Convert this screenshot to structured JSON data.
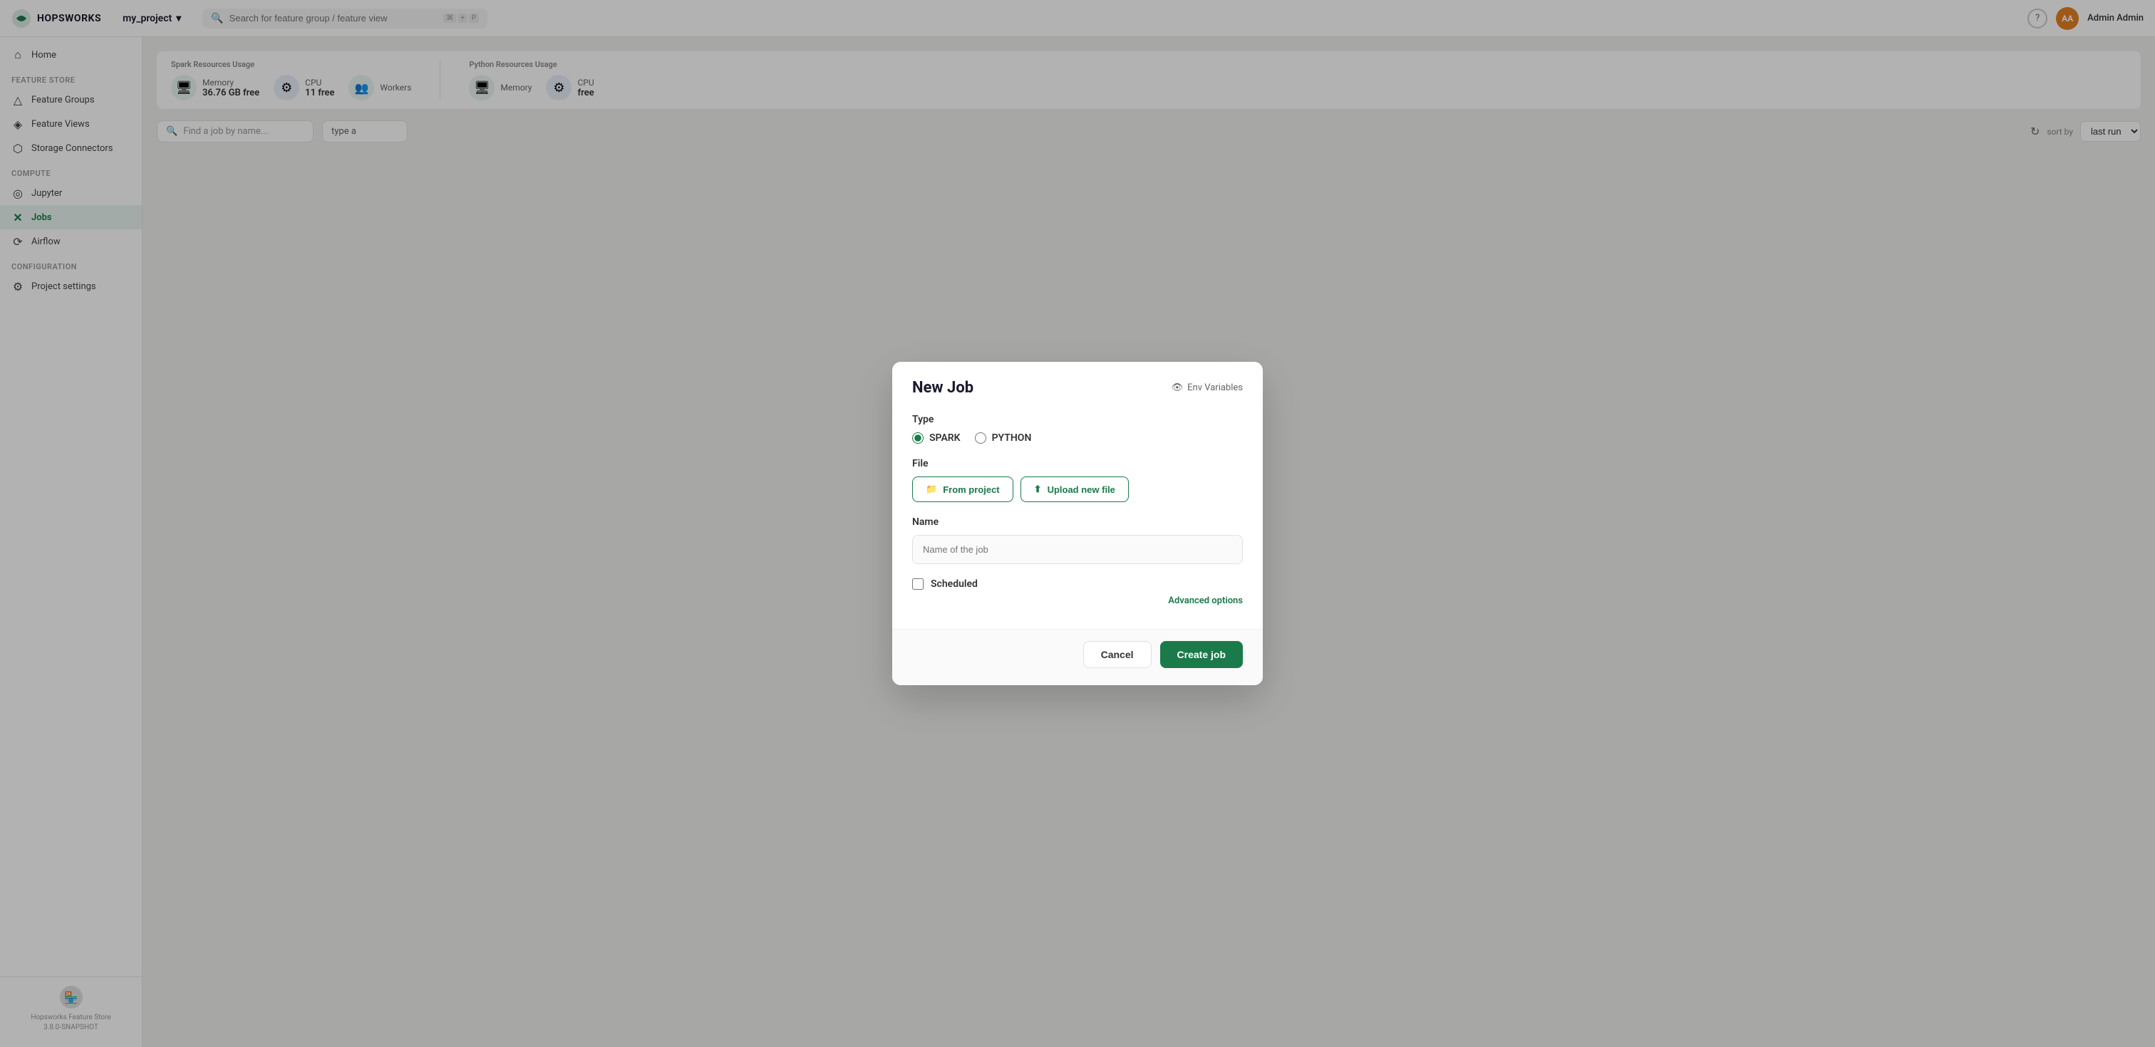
{
  "app": {
    "title": "HOPSWORKS"
  },
  "topbar": {
    "project_name": "my_project",
    "search_placeholder": "Search for feature group / feature view",
    "shortcut_symbol": "⌘",
    "shortcut_plus": "+",
    "shortcut_key": "P",
    "admin_initials": "AA",
    "admin_name": "Admin Admin"
  },
  "sidebar": {
    "home_label": "Home",
    "feature_store_label": "Feature Store",
    "items": [
      {
        "id": "feature-groups",
        "label": "Feature Groups"
      },
      {
        "id": "feature-views",
        "label": "Feature Views"
      },
      {
        "id": "storage-connectors",
        "label": "Storage Connectors"
      }
    ],
    "compute_label": "Compute",
    "compute_items": [
      {
        "id": "jupyter",
        "label": "Jupyter"
      },
      {
        "id": "jobs",
        "label": "Jobs",
        "active": true
      },
      {
        "id": "airflow",
        "label": "Airflow"
      }
    ],
    "config_label": "Configuration",
    "config_items": [
      {
        "id": "project-settings",
        "label": "Project settings"
      }
    ],
    "footer_version": "Hopsworks Feature Store",
    "footer_build": "3.8.0-SNAPSHOT"
  },
  "resources": {
    "spark_label": "Spark Resources Usage",
    "spark_memory_label": "Memory",
    "spark_memory_value": "36.76 GB free",
    "spark_cpu_label": "CPU",
    "spark_cpu_value": "11 free",
    "spark_workers_label": "Workers",
    "python_label": "Python Resources Usage",
    "python_memory_label": "Memory",
    "python_cpu_label": "CPU",
    "python_cpu_value": "free"
  },
  "jobs": {
    "search_placeholder": "Find a job by name...",
    "type_placeholder": "type a",
    "sort_label": "sort by",
    "sort_value": "last run"
  },
  "dialog": {
    "title": "New Job",
    "env_vars_label": "Env Variables",
    "type_label": "Type",
    "spark_label": "SPARK",
    "python_label": "PYTHON",
    "file_label": "File",
    "from_project_label": "From project",
    "upload_label": "Upload new file",
    "name_label": "Name",
    "name_placeholder": "Name of the job",
    "scheduled_label": "Scheduled",
    "advanced_label": "Advanced options",
    "cancel_label": "Cancel",
    "create_label": "Create job"
  }
}
